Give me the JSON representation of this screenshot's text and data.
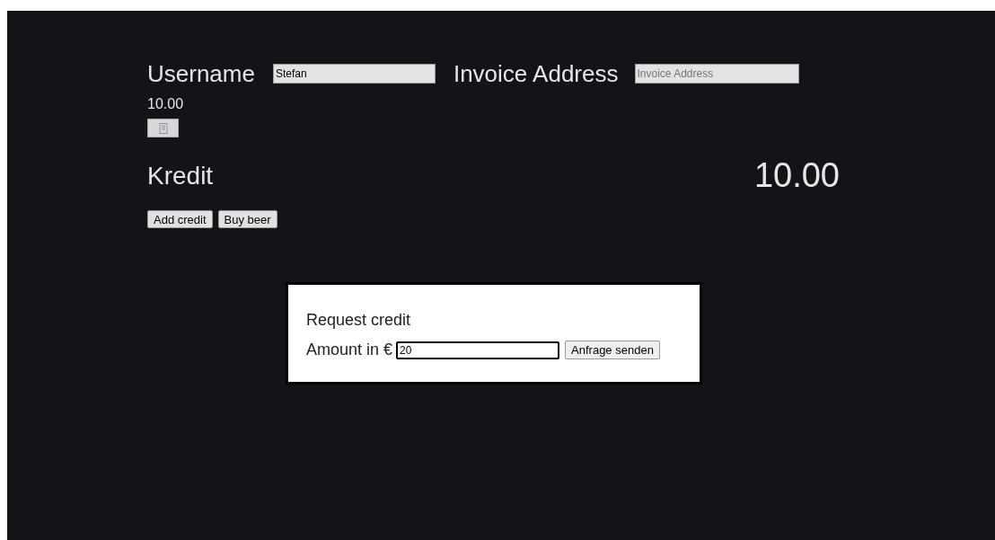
{
  "profile": {
    "username_label": "Username",
    "username_value": "Stefan",
    "invoice_label": "Invoice Address",
    "invoice_placeholder": "Invoice Address",
    "balance": "10.00"
  },
  "credit": {
    "label": "Kredit",
    "amount": "10.00"
  },
  "buttons": [
    "Add credit",
    "Buy beer"
  ],
  "dialog": {
    "title": "Request credit",
    "amount_label": "Amount in €",
    "amount_value": "20",
    "submit": "Anfrage senden"
  }
}
